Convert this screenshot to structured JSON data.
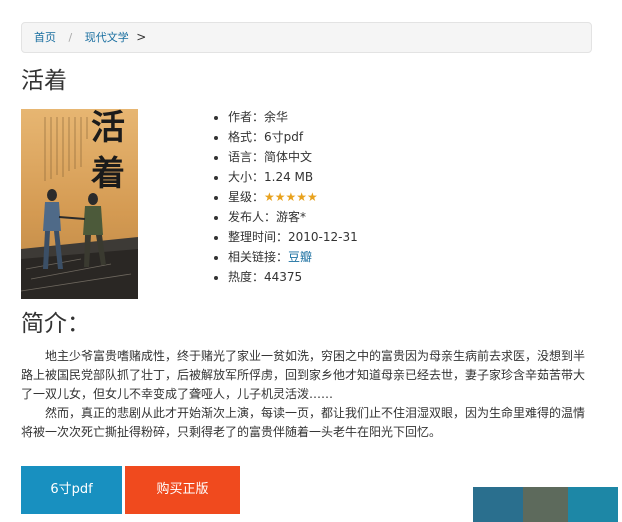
{
  "breadcrumb": {
    "home": "首页",
    "separator": "/",
    "category": "现代文学",
    "trail": ">"
  },
  "book": {
    "title": "活着",
    "cover_text": "活着",
    "cover_label": "book-cover",
    "info": [
      {
        "label": "作者：",
        "value": "余华"
      },
      {
        "label": "格式：",
        "value": "6寸pdf"
      },
      {
        "label": "语言：",
        "value": "简体中文"
      },
      {
        "label": "大小：",
        "value": "1.24 MB"
      },
      {
        "label": "星级：",
        "stars": 5,
        "stars_max": 5
      },
      {
        "label": "发布人：",
        "value": "游客*"
      },
      {
        "label": "整理时间：",
        "value": "2010-12-31"
      },
      {
        "label": "相关链接：",
        "link": "豆瓣"
      },
      {
        "label": "热度：",
        "value": "44375"
      }
    ]
  },
  "intro": {
    "heading": "简介：",
    "paragraphs": [
      "地主少爷富贵嗜赌成性，终于赌光了家业一贫如洗，穷困之中的富贵因为母亲生病前去求医，没想到半路上被国民党部队抓了壮丁，后被解放军所俘虏，回到家乡他才知道母亲已经去世，妻子家珍含辛茹苦带大了一双儿女，但女儿不幸变成了聋哑人，儿子机灵活泼……",
      "然而，真正的悲剧从此才开始渐次上演，每读一页，都让我们止不住泪湿双眼，因为生命里难得的温情将被一次次死亡撕扯得粉碎，只剩得老了的富贵伴随着一头老牛在阳光下回忆。"
    ]
  },
  "buttons": {
    "pdf": "6寸pdf",
    "buy": "购买正版"
  },
  "colors": {
    "link": "#1a6fa0",
    "pdf_button": "#1890c0",
    "buy_button": "#f04a1e",
    "star": "#e8a21e"
  }
}
